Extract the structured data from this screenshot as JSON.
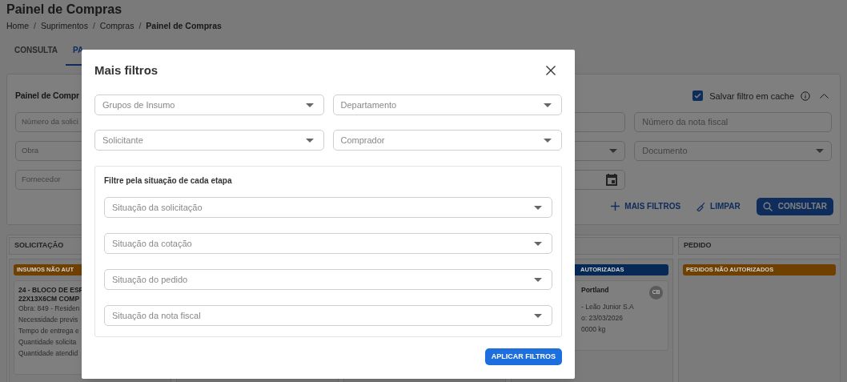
{
  "page": {
    "title": "Painel de Compras",
    "breadcrumb": [
      {
        "kind": "link",
        "text": "Home"
      },
      {
        "kind": "separator",
        "text": "/"
      },
      {
        "kind": "link",
        "text": "Suprimentos"
      },
      {
        "kind": "separator",
        "text": "/"
      },
      {
        "kind": "link",
        "text": "Compras"
      },
      {
        "kind": "separator",
        "text": "/"
      },
      {
        "kind": "current",
        "text": "Painel de Compras"
      }
    ]
  },
  "tabs": [
    {
      "label": "CONSULTA",
      "selected": false
    },
    {
      "label": "PA",
      "selected": true
    }
  ],
  "filter_panel": {
    "title": "Painel de Compr",
    "save_cache": {
      "label": "Salvar filtro em cache",
      "checked": true
    },
    "fields": [
      {
        "kind": "text",
        "placeholder": "Número da solici"
      },
      {
        "kind": "hidden"
      },
      {
        "kind": "text"
      },
      {
        "kind": "text",
        "placeholder": "Número da nota fiscal"
      },
      {
        "kind": "text",
        "placeholder": "Obra"
      },
      {
        "kind": "hidden"
      },
      {
        "kind": "select"
      },
      {
        "kind": "select",
        "placeholder": "Documento"
      },
      {
        "kind": "text",
        "placeholder": "Fornecedor"
      },
      {
        "kind": "hidden"
      },
      {
        "kind": "date"
      }
    ],
    "actions": [
      {
        "kind": "add",
        "label": "MAIS FILTROS"
      },
      {
        "kind": "clear",
        "label": "LIMPAR"
      },
      {
        "kind": "search",
        "label": "CONSULTAR"
      }
    ]
  },
  "board": {
    "columns": [
      {
        "title": "SOLICITAÇÃO",
        "badge": {
          "label": "INSUMOS NÃO AUT",
          "color": "#6f4000"
        },
        "card": {
          "title_lines": [
            "24 - BLOCO DE ESP",
            "22X13X6CM COMP"
          ],
          "lines": [
            "Obra: 849 - Residen",
            "Necessidade previs",
            "Tempo de entrega e",
            "Quantidade solicita",
            "Quantidade atendid"
          ]
        }
      },
      {},
      {},
      {
        "badge": {
          "label": "AUTORIZADAS",
          "color": "#062a55"
        },
        "card": {
          "title_lines": [
            "Portland"
          ],
          "avatar": "CB",
          "lines": [
            "- Leão Junior S.A",
            "o: 23/03/2026",
            "0000 kg"
          ]
        }
      },
      {
        "title": "PEDIDO",
        "badge": {
          "label": "PEDIDOS NÃO AUTORIZADOS",
          "color": "#6f4000"
        }
      }
    ]
  },
  "modal": {
    "title": "Mais filtros",
    "selects": [
      {
        "placeholder": "Grupos de Insumo"
      },
      {
        "placeholder": "Departamento"
      },
      {
        "placeholder": "Solicitante"
      },
      {
        "placeholder": "Comprador"
      }
    ],
    "section": {
      "title": "Filtre pela situação de cada etapa",
      "selects": [
        {
          "placeholder": "Situação da solicitação"
        },
        {
          "placeholder": "Situação da cotação"
        },
        {
          "placeholder": "Situação do pedido"
        },
        {
          "placeholder": "Situação da nota fiscal"
        }
      ]
    },
    "apply_button": "APLICAR FILTROS"
  }
}
